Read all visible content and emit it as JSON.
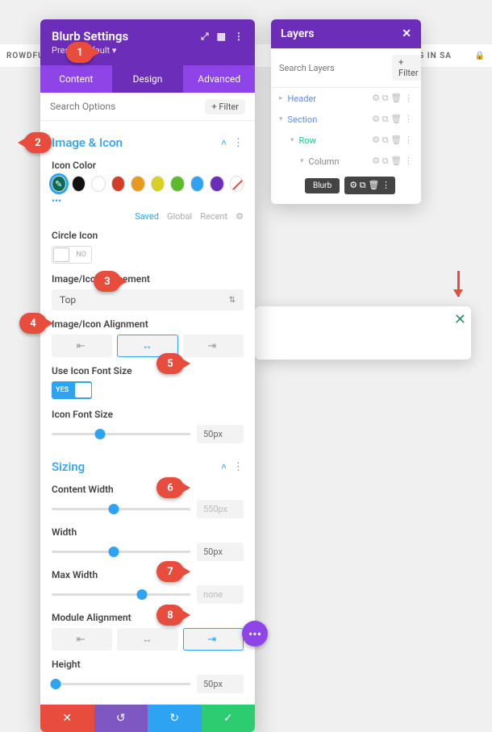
{
  "bg": {
    "left_text": "ROWDFU",
    "right_text": "Y LIVING IN SA"
  },
  "layers": {
    "title": "Layers",
    "search_placeholder": "Search Layers",
    "filter": "+ Filter",
    "items": [
      "Header",
      "Section",
      "Row",
      "Column"
    ],
    "blurb": "Blurb"
  },
  "settings": {
    "title": "Blurb Settings",
    "preset": "Preset: Default ▾",
    "tabs": [
      "Content",
      "Design",
      "Advanced"
    ],
    "search_placeholder": "Search Options",
    "filter": "+ Filter",
    "image_icon": {
      "title": "Image & Icon",
      "icon_color_label": "Icon Color",
      "swatches": [
        "#0a6b55",
        "#111111",
        "#ffffff",
        "#d43d27",
        "#e89a1e",
        "#d9d024",
        "#5bbb2b",
        "#2ea3f2",
        "#6c2eb9",
        "none"
      ],
      "sub_links": [
        "Saved",
        "Global",
        "Recent"
      ],
      "circle_icon_label": "Circle Icon",
      "circle_icon_value": "NO",
      "placement_label": "Image/Icon Placement",
      "placement_value": "Top",
      "alignment_label": "Image/Icon Alignment",
      "use_font_size_label": "Use Icon Font Size",
      "use_font_size_value": "YES",
      "icon_font_size_label": "Icon Font Size",
      "icon_font_size_value": "50px"
    },
    "sizing": {
      "title": "Sizing",
      "content_width_label": "Content Width",
      "content_width_value": "550px",
      "width_label": "Width",
      "width_value": "50px",
      "max_width_label": "Max Width",
      "max_width_value": "none",
      "module_alignment_label": "Module Alignment",
      "height_label": "Height",
      "height_value": "50px"
    }
  },
  "callouts": {
    "c1": "1",
    "c2": "2",
    "c3": "3",
    "c4": "4",
    "c5": "5",
    "c6": "6",
    "c7": "7",
    "c8": "8"
  }
}
